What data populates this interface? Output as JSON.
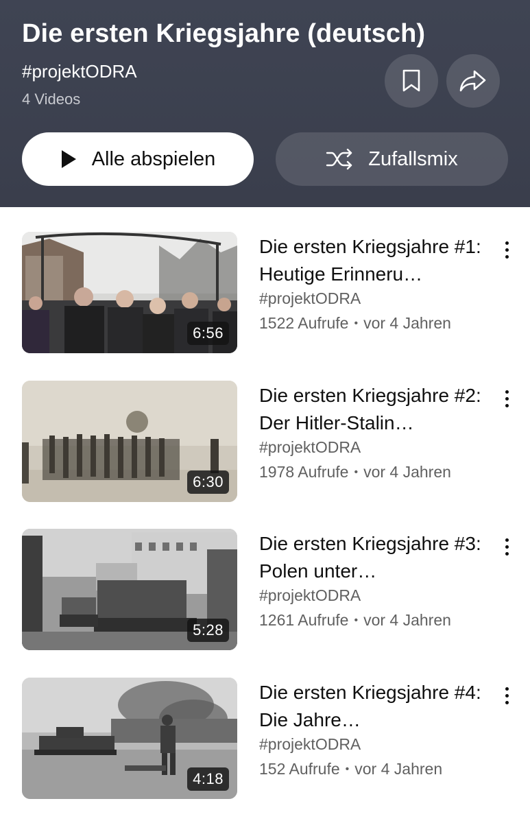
{
  "playlist": {
    "title": "Die ersten Kriegsjahre (deutsch)",
    "channel": "#projektODRA",
    "video_count": "4 Videos"
  },
  "actions": {
    "play_all_label": "Alle abspielen",
    "shuffle_label": "Zufallsmix",
    "save_icon": "bookmark-icon",
    "share_icon": "share-icon"
  },
  "videos": [
    {
      "title": "Die ersten Kriegsjahre #1: Heutige Erinneru…",
      "channel": "#projektODRA",
      "views": "1522 Aufrufe",
      "age": "vor 4 Jahren",
      "duration": "6:56"
    },
    {
      "title": "Die ersten Kriegsjahre #2: Der Hitler-Stalin…",
      "channel": "#projektODRA",
      "views": "1978 Aufrufe",
      "age": "vor 4 Jahren",
      "duration": "6:30"
    },
    {
      "title": "Die ersten Kriegsjahre #3: Polen unter…",
      "channel": "#projektODRA",
      "views": "1261 Aufrufe",
      "age": "vor 4 Jahren",
      "duration": "5:28"
    },
    {
      "title": "Die ersten Kriegsjahre #4: Die Jahre…",
      "channel": "#projektODRA",
      "views": "152 Aufrufe",
      "age": "vor 4 Jahren",
      "duration": "4:18"
    }
  ],
  "meta_separator": "•",
  "colors": {
    "header_bg": "#3f4453",
    "text_primary": "#0f0f0f",
    "text_secondary": "#606060"
  }
}
